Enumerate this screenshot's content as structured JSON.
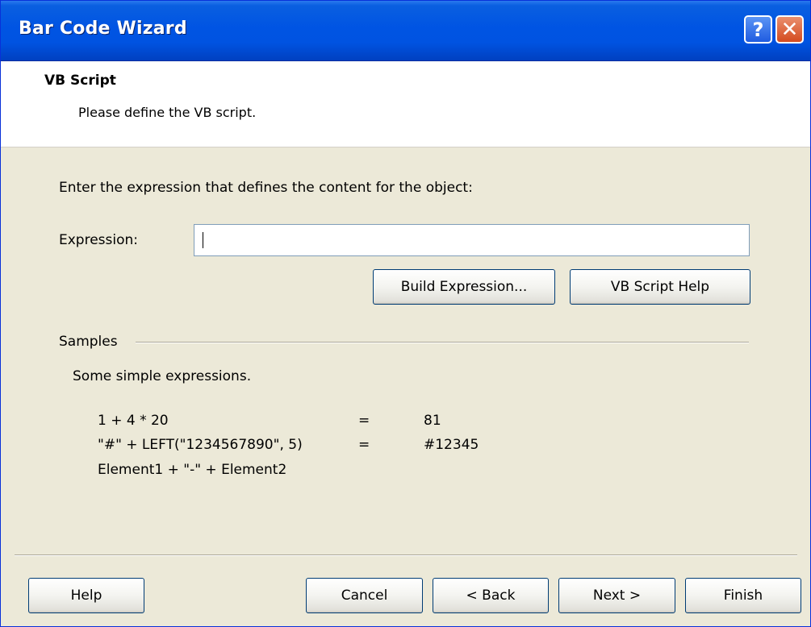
{
  "window": {
    "title": "Bar Code Wizard"
  },
  "header": {
    "title": "VB Script",
    "subtitle": "Please define the VB script."
  },
  "main": {
    "instruction": "Enter the expression that defines the content for the object:",
    "expression_label": "Expression:",
    "expression_value": "",
    "build_button": "Build Expression...",
    "help_button": "VB Script Help",
    "samples_label": "Samples",
    "samples_desc": "Some simple expressions.",
    "samples": [
      {
        "expr": "1 + 4 * 20",
        "eq": "=",
        "result": "81"
      },
      {
        "expr": "\"#\" + LEFT(\"1234567890\", 5)",
        "eq": "=",
        "result": "#12345"
      },
      {
        "expr": "Element1 + \"-\" + Element2",
        "eq": "",
        "result": ""
      }
    ]
  },
  "footer": {
    "help": "Help",
    "cancel": "Cancel",
    "back": "< Back",
    "next": "Next >",
    "finish": "Finish"
  },
  "titlebar_buttons": {
    "help": "?",
    "close": "✕"
  }
}
